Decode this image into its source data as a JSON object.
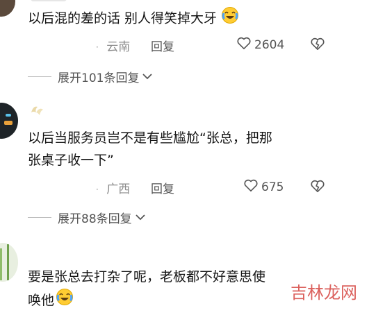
{
  "comments": [
    {
      "text": "以后混的差的话 别人得笑掉大牙",
      "location": "云南",
      "reply_label": "回复",
      "likes": "2604",
      "expand_label": "展开101条回复"
    },
    {
      "text_line1": "以后当服务员岂不是有些尴尬“张总，把那",
      "text_line2": "张桌子收一下”",
      "location": "广西",
      "reply_label": "回复",
      "likes": "675",
      "expand_label": "展开88条回复"
    },
    {
      "text_line1": "要是张总去打杂了呢，老板都不好意思使",
      "text_line2": "唤他"
    }
  ],
  "watermark": "吉林龙网",
  "colors": {
    "text": "#161616",
    "meta": "#8c8c8c",
    "watermark": "#d9534f"
  },
  "icons": [
    "laugh-cry-emoji",
    "heart-outline-icon",
    "broken-heart-icon",
    "chevron-down-icon"
  ]
}
